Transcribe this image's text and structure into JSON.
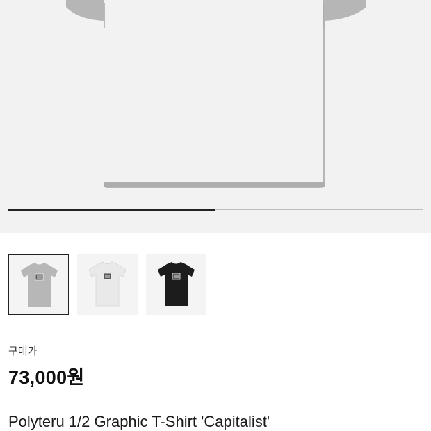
{
  "gallery": {
    "progress_fraction": 0.5,
    "thumbnails": [
      {
        "name": "thumbnail-grey-tshirt",
        "shirt_color": "#b7b7b7",
        "selected": true
      },
      {
        "name": "thumbnail-white-tshirt",
        "shirt_color": "#e9e9e9",
        "selected": false
      },
      {
        "name": "thumbnail-black-tshirt",
        "shirt_color": "#1c1c1c",
        "selected": false
      }
    ],
    "hero_shirt_color": "#b6b6b6"
  },
  "price": {
    "label": "구매가",
    "value": "73,000원"
  },
  "product": {
    "name": "Polyteru 1/2 Graphic T-Shirt 'Capitalist'"
  },
  "colors": {
    "accent": "#222222",
    "background": "#f2f2f2"
  }
}
